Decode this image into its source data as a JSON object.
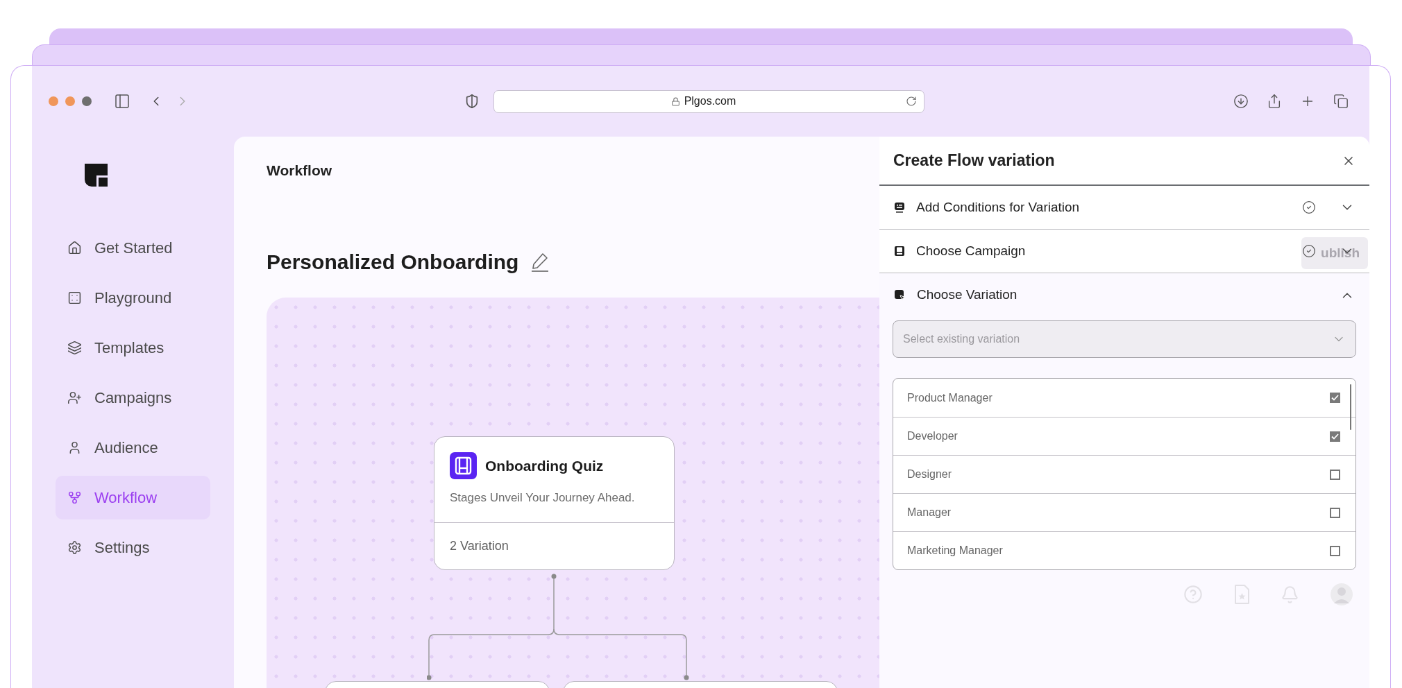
{
  "browser": {
    "url": "Plgos.com"
  },
  "sidebar": {
    "items": [
      {
        "label": "Get Started",
        "selected": false
      },
      {
        "label": "Playground",
        "selected": false
      },
      {
        "label": "Templates",
        "selected": false
      },
      {
        "label": "Campaigns",
        "selected": false
      },
      {
        "label": "Audience",
        "selected": false
      },
      {
        "label": "Workflow",
        "selected": true
      },
      {
        "label": "Settings",
        "selected": false
      }
    ]
  },
  "page": {
    "header": "Workflow",
    "title": "Personalized Onboarding"
  },
  "canvas": {
    "node": {
      "title": "Onboarding Quiz",
      "description": "Stages Unveil Your Journey Ahead.",
      "footer": "2 Variation"
    }
  },
  "background_button": {
    "label": "ublish"
  },
  "panel": {
    "title": "Create Flow variation",
    "sections": [
      {
        "label": "Add Conditions for Variation",
        "complete": true,
        "expanded": false
      },
      {
        "label": "Choose Campaign",
        "complete": true,
        "expanded": false
      },
      {
        "label": "Choose Variation",
        "complete": false,
        "expanded": true
      }
    ],
    "select": {
      "placeholder": "Select existing variation"
    },
    "options": [
      {
        "label": "Product Manager",
        "checked": true
      },
      {
        "label": "Developer",
        "checked": true
      },
      {
        "label": "Designer",
        "checked": false
      },
      {
        "label": "Manager",
        "checked": false
      },
      {
        "label": "Marketing Manager",
        "checked": false
      }
    ]
  }
}
